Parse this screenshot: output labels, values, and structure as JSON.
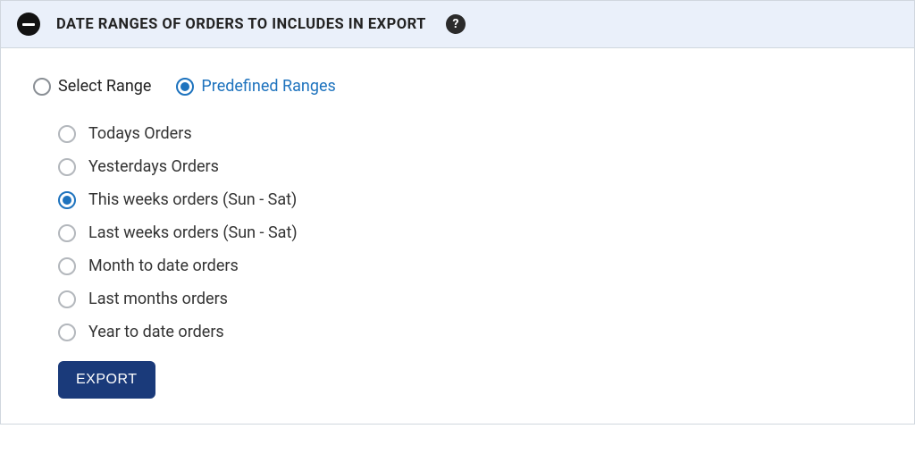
{
  "panel": {
    "title": "DATE RANGES OF ORDERS TO INCLUDES IN EXPORT"
  },
  "mode": {
    "select_range": {
      "label": "Select Range",
      "selected": false
    },
    "predefined": {
      "label": "Predefined Ranges",
      "selected": true
    }
  },
  "ranges": [
    {
      "label": "Todays Orders",
      "selected": false
    },
    {
      "label": "Yesterdays Orders",
      "selected": false
    },
    {
      "label": "This weeks orders (Sun - Sat)",
      "selected": true
    },
    {
      "label": "Last weeks orders (Sun - Sat)",
      "selected": false
    },
    {
      "label": "Month to date orders",
      "selected": false
    },
    {
      "label": "Last months orders",
      "selected": false
    },
    {
      "label": "Year to date orders",
      "selected": false
    }
  ],
  "actions": {
    "export": "EXPORT"
  },
  "help_glyph": "?"
}
